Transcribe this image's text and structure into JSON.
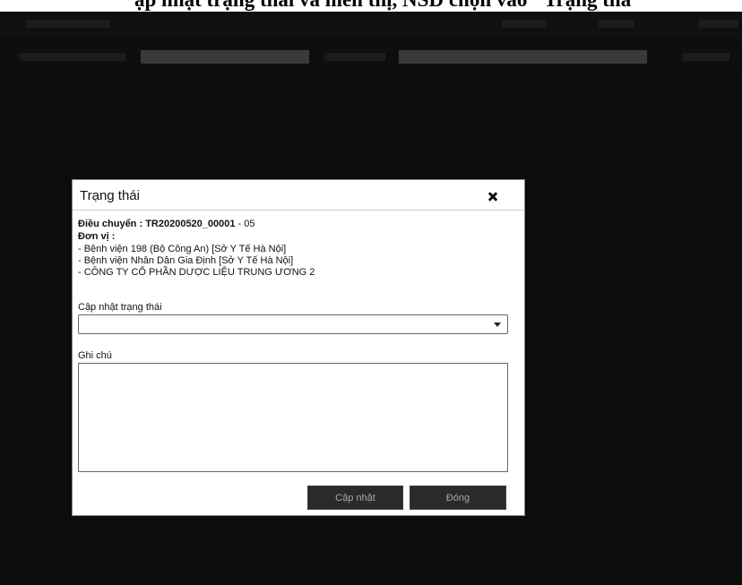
{
  "document_caption": "ập nhật trạng thái và hiển thị, NSD chọn vào \"Trạng thá",
  "icons": {
    "close": "close-icon",
    "dropdown": "caret-down-icon"
  },
  "colors": {
    "overlay": "#0c0c0c",
    "modal_background": "#ffffff",
    "button_background": "#2a2a2a",
    "button_text": "#a8a8a8"
  },
  "modal": {
    "title": "Trạng thái",
    "transfer_label": "Điều chuyển : ",
    "transfer_code": "TR20200520_00001",
    "transfer_suffix": " - 05",
    "unit_label": "Đơn vị :",
    "units": [
      "- Bệnh viện 198 (Bộ Công An) [Sở Y Tế Hà Nội]",
      "- Bệnh viện Nhân Dân Gia Định [Sở Y Tế Hà Nội]",
      "- CÔNG TY CỔ PHẦN DƯỢC LIỆU TRUNG ƯƠNG 2"
    ],
    "status_label": "Cập nhật trạng thái",
    "status_value": "",
    "note_label": "Ghi chú",
    "note_value": "",
    "update_button": "Cập nhật",
    "close_button": "Đóng"
  }
}
